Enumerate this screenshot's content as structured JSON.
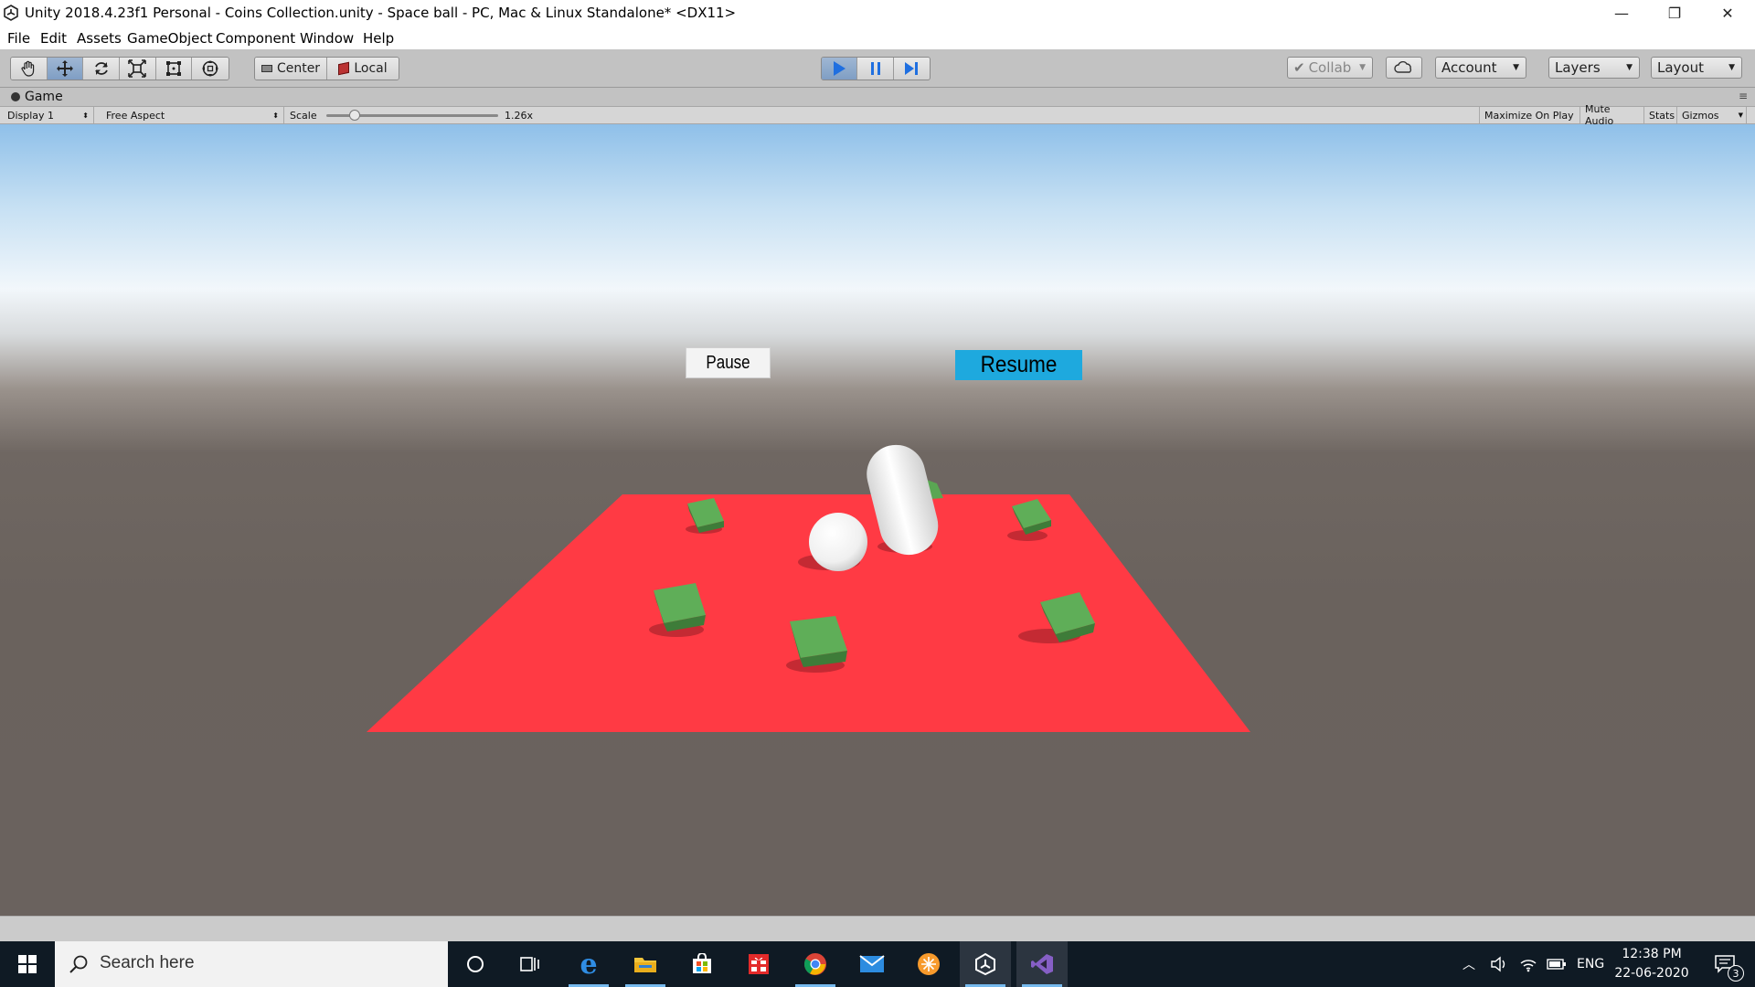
{
  "window": {
    "title": "Unity 2018.4.23f1 Personal - Coins Collection.unity - Space ball - PC, Mac & Linux Standalone* <DX11>",
    "controls": {
      "minimize": "—",
      "restore": "❐",
      "close": "✕"
    }
  },
  "menu": [
    "File",
    "Edit",
    "Assets",
    "GameObject",
    "Component",
    "Window",
    "Help"
  ],
  "toolbar": {
    "tools": [
      "hand-tool-icon",
      "move-tool-icon",
      "rotate-tool-icon",
      "scale-tool-icon",
      "rect-tool-icon",
      "transform-tool-icon"
    ],
    "pivot_label": "Center",
    "space_label": "Local",
    "play": {
      "play_icon": "play-icon",
      "pause_icon": "pause-icon",
      "step_icon": "step-icon",
      "playing": true
    },
    "collab_label": "Collab",
    "account_label": "Account",
    "layers_label": "Layers",
    "layout_label": "Layout"
  },
  "game_panel": {
    "tab_label": "Game",
    "display_label": "Display 1",
    "aspect_label": "Free Aspect",
    "scale_label": "Scale",
    "scale_value": "1.26x",
    "scale_fraction": 0.14,
    "maximize_label": "Maximize On Play",
    "mute_label": "Mute Audio",
    "stats_label": "Stats",
    "gizmos_label": "Gizmos"
  },
  "game_ui": {
    "pause_label": "Pause",
    "resume_label": "Resume",
    "resume_color": "#1ea9de",
    "plane_color": "#ff3a44",
    "cube_color": "#4e9a47"
  },
  "taskbar": {
    "search_placeholder": "Search here",
    "apps": [
      "cortana-icon",
      "task-view-icon",
      "edge-icon",
      "file-explorer-icon",
      "store-icon",
      "gift-icon",
      "chrome-icon",
      "mail-icon",
      "orange-app-icon",
      "unity-icon",
      "visual-studio-icon"
    ],
    "lang": "ENG",
    "time": "12:38 PM",
    "date": "22-06-2020",
    "notification_count": "3"
  }
}
